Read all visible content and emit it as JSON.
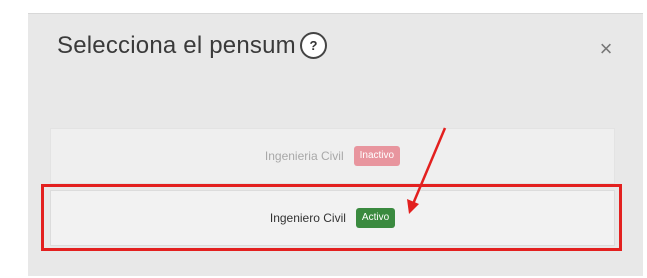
{
  "modal": {
    "title": "Selecciona el pensum",
    "help_label": "?",
    "close_label": "×"
  },
  "options": [
    {
      "label": "Ingenieria Civil",
      "badge": "Inactivo",
      "status": "inactive"
    },
    {
      "label": "Ingeniero Civil",
      "badge": "Activo",
      "status": "active"
    }
  ],
  "colors": {
    "badge_inactive": "#e8959e",
    "badge_active": "#3a8a3f",
    "annotation_red": "#e3201f"
  }
}
